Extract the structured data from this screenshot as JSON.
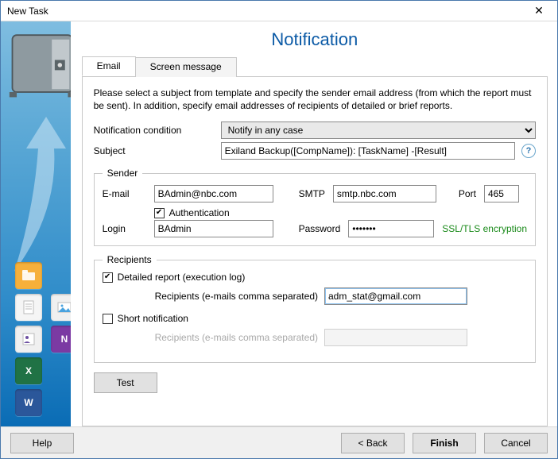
{
  "window": {
    "title": "New Task"
  },
  "heading": "Notification",
  "tabs": {
    "email": "Email",
    "screen": "Screen message"
  },
  "description": "Please select a subject from template and specify the sender email address (from which the report must be sent). In addition, specify email addresses of recipients of detailed or brief reports.",
  "condition": {
    "label": "Notification condition",
    "value": "Notify in any case"
  },
  "subject": {
    "label": "Subject",
    "value": "Exiland Backup([CompName]): [TaskName] -[Result]"
  },
  "sender": {
    "legend": "Sender",
    "email_label": "E-mail",
    "email": "BAdmin@nbc.com",
    "smtp_label": "SMTP",
    "smtp": "smtp.nbc.com",
    "port_label": "Port",
    "port": "465",
    "auth_label": "Authentication",
    "auth_checked": true,
    "login_label": "Login",
    "login": "BAdmin",
    "password_label": "Password",
    "password": "•••••••",
    "ssl": "SSL/TLS encryption"
  },
  "recipients": {
    "legend": "Recipients",
    "detailed_label": "Detailed report (execution log)",
    "detailed_checked": true,
    "detailed_recipients_label": "Recipients (e-mails comma separated)",
    "detailed_recipients": "adm_stat@gmail.com",
    "short_label": "Short notification",
    "short_checked": false,
    "short_recipients_label": "Recipients (e-mails comma separated)",
    "short_recipients": ""
  },
  "buttons": {
    "test": "Test",
    "help": "Help",
    "back": "<  Back",
    "finish": "Finish",
    "cancel": "Cancel"
  },
  "icons": {
    "close": "✕",
    "help_q": "?",
    "check": "✔",
    "side": [
      "folder-network",
      "document",
      "photo",
      "contacts",
      "onenote",
      "excel",
      "word"
    ]
  }
}
